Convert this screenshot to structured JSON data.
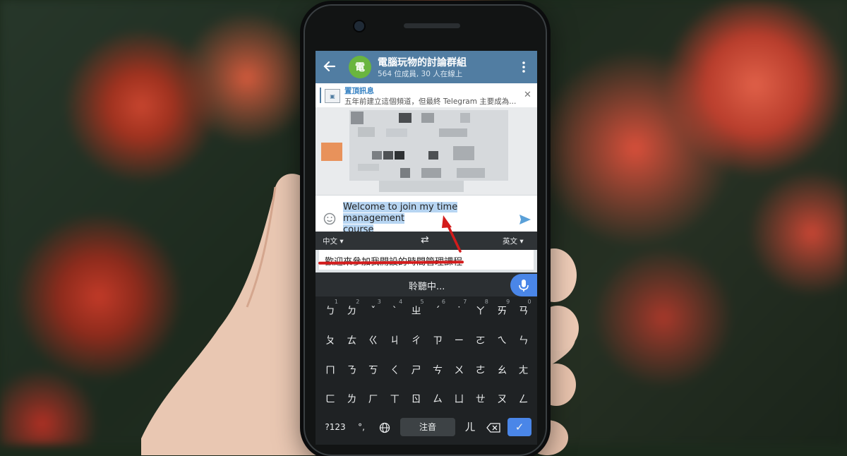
{
  "chat": {
    "title": "電腦玩物的討論群組",
    "avatar_letter": "電",
    "subtitle": "564 位成員, 30 人在線上",
    "header_color": "#517da2"
  },
  "pinned": {
    "title": "置頂訊息",
    "text": "五年前建立這個頻道，但最終 Telegram 主要成為..."
  },
  "input": {
    "message_line1": "Welcome to join my time management",
    "message_line2": "course"
  },
  "translator": {
    "source_lang": "中文",
    "target_lang": "英文",
    "swap_icon": "⇄",
    "translated_text": "歡迎來參加我開設的時間管理課程"
  },
  "voice": {
    "listening_text": "聆聽中..."
  },
  "keyboard": {
    "row1": [
      "ㄅ",
      "ㄉ",
      "ˇ",
      "ˋ",
      "ㄓ",
      "ˊ",
      "˙",
      "ㄚ",
      "ㄞ",
      "ㄢ"
    ],
    "row1_nums": [
      "1",
      "2",
      "3",
      "4",
      "5",
      "6",
      "7",
      "8",
      "9",
      "0"
    ],
    "row2": [
      "ㄆ",
      "ㄊ",
      "ㄍ",
      "ㄐ",
      "ㄔ",
      "ㄗ",
      "ㄧ",
      "ㄛ",
      "ㄟ",
      "ㄣ"
    ],
    "row3": [
      "ㄇ",
      "ㄋ",
      "ㄎ",
      "ㄑ",
      "ㄕ",
      "ㄘ",
      "ㄨ",
      "ㄜ",
      "ㄠ",
      "ㄤ"
    ],
    "row4": [
      "ㄈ",
      "ㄌ",
      "ㄏ",
      "ㄒ",
      "ㄖ",
      "ㄙ",
      "ㄩ",
      "ㄝ",
      "ㄡ",
      "ㄥ"
    ],
    "symbols_key": "?123",
    "punct_key": "°,",
    "space_label": "注音",
    "er_key": "ㄦ",
    "enter_icon": "✓"
  },
  "annotation_color": "#d31c1c"
}
